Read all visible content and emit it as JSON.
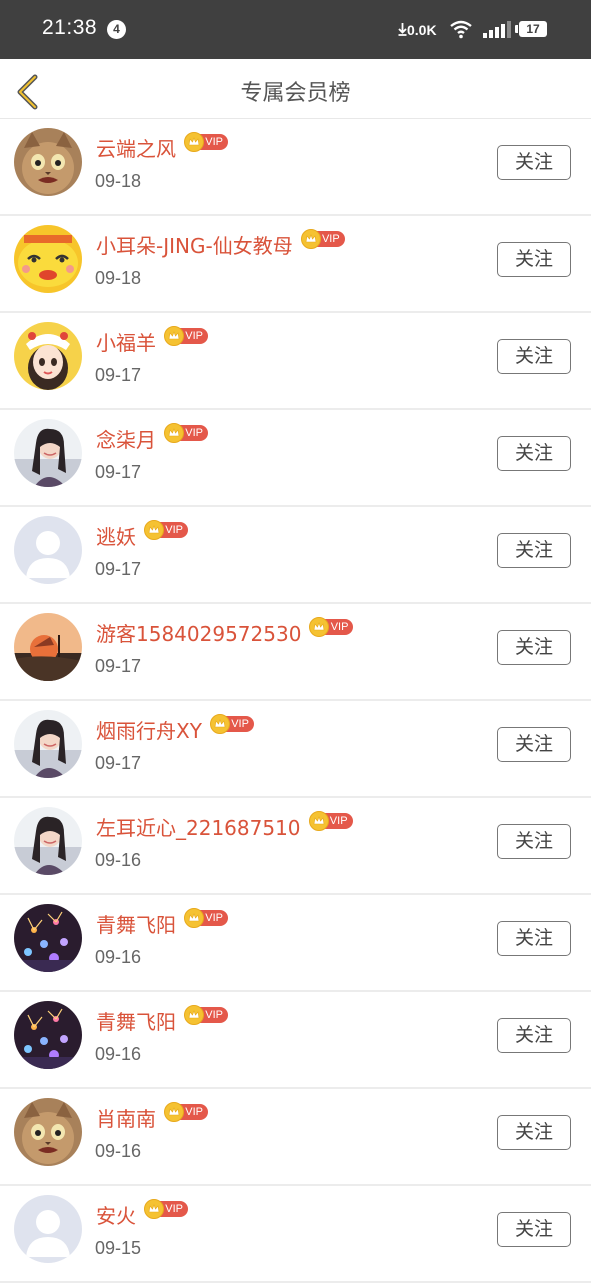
{
  "status_bar": {
    "time": "21:38",
    "notification_count": "4",
    "net_speed": "0.0K",
    "battery": "17"
  },
  "header": {
    "title": "专属会员榜"
  },
  "colors": {
    "name": "#d9533a",
    "vip_pill": "#e4584a",
    "crown": "#f5c232",
    "status_bar": "#404040"
  },
  "members": [
    {
      "name": "云端之风",
      "badge": "VIP",
      "date": "09-18",
      "follow_label": "关注",
      "avatar_icon": "cat-avatar"
    },
    {
      "name": "小耳朵-JING-仙女教母",
      "badge": "VIP",
      "date": "09-18",
      "follow_label": "关注",
      "avatar_icon": "yellow-cartoon-avatar"
    },
    {
      "name": "小福羊",
      "badge": "VIP",
      "date": "09-17",
      "follow_label": "关注",
      "avatar_icon": "cartoon-girl-avatar"
    },
    {
      "name": "念柒月",
      "badge": "VIP",
      "date": "09-17",
      "follow_label": "关注",
      "avatar_icon": "girl-photo-avatar"
    },
    {
      "name": "逃妖",
      "badge": "VIP",
      "date": "09-17",
      "follow_label": "关注",
      "avatar_icon": "default-user-avatar"
    },
    {
      "name": "游客1584029572530",
      "badge": "VIP",
      "date": "09-17",
      "follow_label": "关注",
      "avatar_icon": "sunset-avatar"
    },
    {
      "name": "烟雨行舟XY",
      "badge": "VIP",
      "date": "09-17",
      "follow_label": "关注",
      "avatar_icon": "girl-photo-avatar"
    },
    {
      "name": "左耳近心_221687510",
      "badge": "VIP",
      "date": "09-16",
      "follow_label": "关注",
      "avatar_icon": "girl-photo-avatar"
    },
    {
      "name": "青舞飞阳",
      "badge": "VIP",
      "date": "09-16",
      "follow_label": "关注",
      "avatar_icon": "fireworks-avatar"
    },
    {
      "name": "青舞飞阳",
      "badge": "VIP",
      "date": "09-16",
      "follow_label": "关注",
      "avatar_icon": "fireworks-avatar"
    },
    {
      "name": "肖南南",
      "badge": "VIP",
      "date": "09-16",
      "follow_label": "关注",
      "avatar_icon": "cat-avatar"
    },
    {
      "name": "安火",
      "badge": "VIP",
      "date": "09-15",
      "follow_label": "关注",
      "avatar_icon": "default-user-avatar"
    }
  ]
}
